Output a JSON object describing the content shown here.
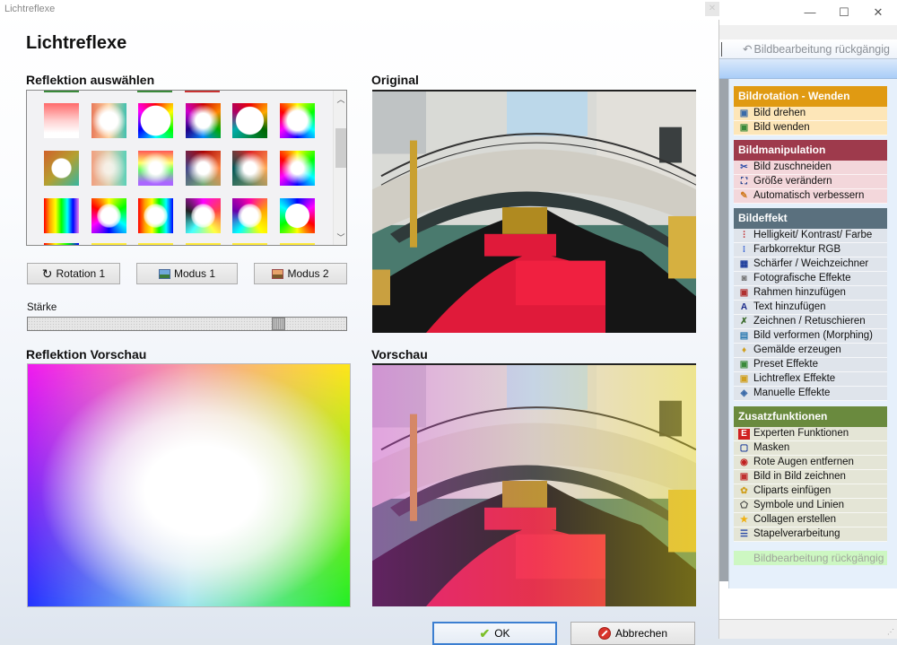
{
  "dialog": {
    "window_title": "Lichtreflexe",
    "heading": "Lichtreflexe",
    "gallery_title": "Reflektion auswählen",
    "original_title": "Original",
    "preview_refl_title": "Reflektion Vorschau",
    "preview_title": "Vorschau",
    "buttons": {
      "rotation": "Rotation 1",
      "mode1": "Modus 1",
      "mode2": "Modus 2",
      "ok": "OK",
      "cancel": "Abbrechen"
    },
    "strength_label": "Stärke",
    "strength_value_fraction": 0.8,
    "gallery_scroll_position": 0.3,
    "gallery": {
      "rows": 3,
      "columns": 6,
      "selected": null
    }
  },
  "app": {
    "window_controls": {
      "minimize": "—",
      "maximize": "☐",
      "close": "✕"
    },
    "undo_top": "Bildbearbeitung rückgängig",
    "undo_bottom": "Bildbearbeitung rückgängig",
    "groups": [
      {
        "title": "Bildrotation - Wenden",
        "color": "#e09a12",
        "items": [
          {
            "label": "Bild drehen",
            "icon": "rotate-image-icon"
          },
          {
            "label": "Bild wenden",
            "icon": "flip-image-icon"
          }
        ]
      },
      {
        "title": "Bildmanipulation",
        "color": "#9e3a4c",
        "items": [
          {
            "label": "Bild zuschneiden",
            "icon": "scissors-icon"
          },
          {
            "label": "Größe verändern",
            "icon": "resize-icon"
          },
          {
            "label": "Automatisch verbessern",
            "icon": "magic-wand-icon"
          }
        ]
      },
      {
        "title": "Bildeffekt",
        "color": "#5a707e",
        "items": [
          {
            "label": "Helligkeit/ Kontrast/ Farbe",
            "icon": "brightness-icon"
          },
          {
            "label": "Farbkorrektur RGB",
            "icon": "rgb-icon"
          },
          {
            "label": "Schärfer / Weichzeichner",
            "icon": "sharpen-icon"
          },
          {
            "label": "Fotografische Effekte",
            "icon": "camera-icon"
          },
          {
            "label": "Rahmen hinzufügen",
            "icon": "frame-icon"
          },
          {
            "label": "Text hinzufügen",
            "icon": "text-icon"
          },
          {
            "label": "Zeichnen / Retuschieren",
            "icon": "draw-icon"
          },
          {
            "label": "Bild verformen (Morphing)",
            "icon": "morph-icon"
          },
          {
            "label": "Gemälde erzeugen",
            "icon": "paint-icon"
          },
          {
            "label": "Preset Effekte",
            "icon": "preset-icon"
          },
          {
            "label": "Lichtreflex Effekte",
            "icon": "light-reflex-icon"
          },
          {
            "label": "Manuelle Effekte",
            "icon": "manual-effects-icon"
          }
        ]
      },
      {
        "title": "Zusatzfunktionen",
        "color": "#6a8a3e",
        "items": [
          {
            "label": "Experten Funktionen",
            "icon": "expert-icon"
          },
          {
            "label": "Masken",
            "icon": "mask-icon"
          },
          {
            "label": "Rote Augen entfernen",
            "icon": "red-eye-icon"
          },
          {
            "label": "Bild in Bild zeichnen",
            "icon": "picture-in-picture-icon"
          },
          {
            "label": "Cliparts einfügen",
            "icon": "clipart-icon"
          },
          {
            "label": "Symbole und Linien",
            "icon": "symbols-icon"
          },
          {
            "label": "Collagen erstellen",
            "icon": "star-icon"
          },
          {
            "label": "Stapelverarbeitung",
            "icon": "batch-icon"
          }
        ]
      }
    ]
  }
}
